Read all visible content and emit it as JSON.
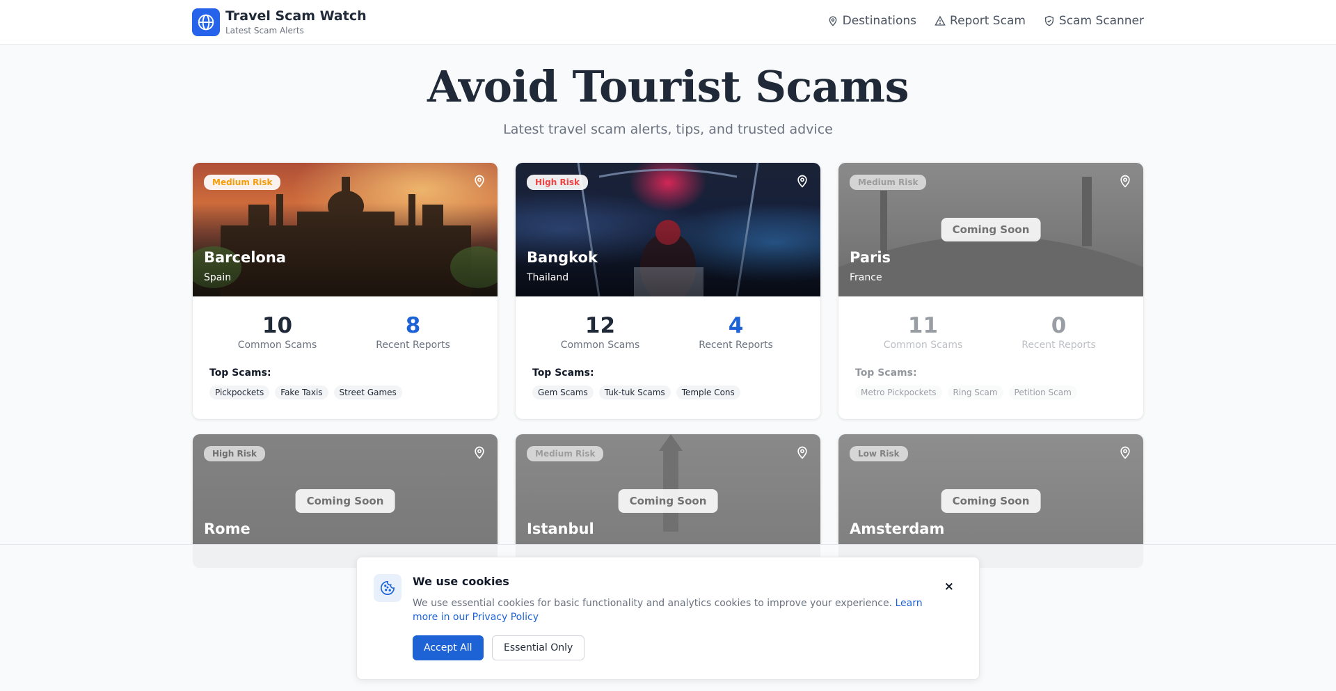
{
  "header": {
    "title": "Travel Scam Watch",
    "subtitle": "Latest Scam Alerts",
    "nav": [
      {
        "label": "Destinations",
        "icon": "map-pin-icon"
      },
      {
        "label": "Report Scam",
        "icon": "warning-icon"
      },
      {
        "label": "Scam Scanner",
        "icon": "shield-icon"
      }
    ]
  },
  "hero": {
    "title": "Avoid Tourist Scams",
    "subtitle": "Latest travel scam alerts, tips, and trusted advice"
  },
  "cards": [
    {
      "risk": "Medium Risk",
      "city": "Barcelona",
      "country": "Spain",
      "common_scams": "10",
      "recent_reports": "8",
      "common_label": "Common Scams",
      "reports_label": "Recent Reports",
      "top_label": "Top Scams:",
      "tags": [
        "Pickpockets",
        "Fake Taxis",
        "Street Games"
      ]
    },
    {
      "risk": "High Risk",
      "city": "Bangkok",
      "country": "Thailand",
      "common_scams": "12",
      "recent_reports": "4",
      "common_label": "Common Scams",
      "reports_label": "Recent Reports",
      "top_label": "Top Scams:",
      "tags": [
        "Gem Scams",
        "Tuk-tuk Scams",
        "Temple Cons"
      ]
    },
    {
      "risk": "Medium Risk",
      "city": "Paris",
      "country": "France",
      "coming_soon": "Coming Soon",
      "common_scams": "11",
      "recent_reports": "0",
      "common_label": "Common Scams",
      "reports_label": "Recent Reports",
      "top_label": "Top Scams:",
      "tags": [
        "Metro Pickpockets",
        "Ring Scam",
        "Petition Scam"
      ]
    },
    {
      "risk": "High Risk",
      "city": "Rome",
      "coming_soon": "Coming Soon"
    },
    {
      "risk": "Medium Risk",
      "city": "Istanbul",
      "coming_soon": "Coming Soon"
    },
    {
      "risk": "Low Risk",
      "city": "Amsterdam",
      "coming_soon": "Coming Soon"
    }
  ],
  "cookie": {
    "title": "We use cookies",
    "text": "We use essential cookies for basic functionality and analytics cookies to improve your experience.",
    "link": "Learn more in our Privacy Policy",
    "accept": "Accept All",
    "essential": "Essential Only",
    "close": "×"
  },
  "colors": {
    "accent": "#1d63d6",
    "risk_medium": "#f59e0b",
    "risk_high": "#ef4444",
    "risk_low": "#16a34a"
  }
}
